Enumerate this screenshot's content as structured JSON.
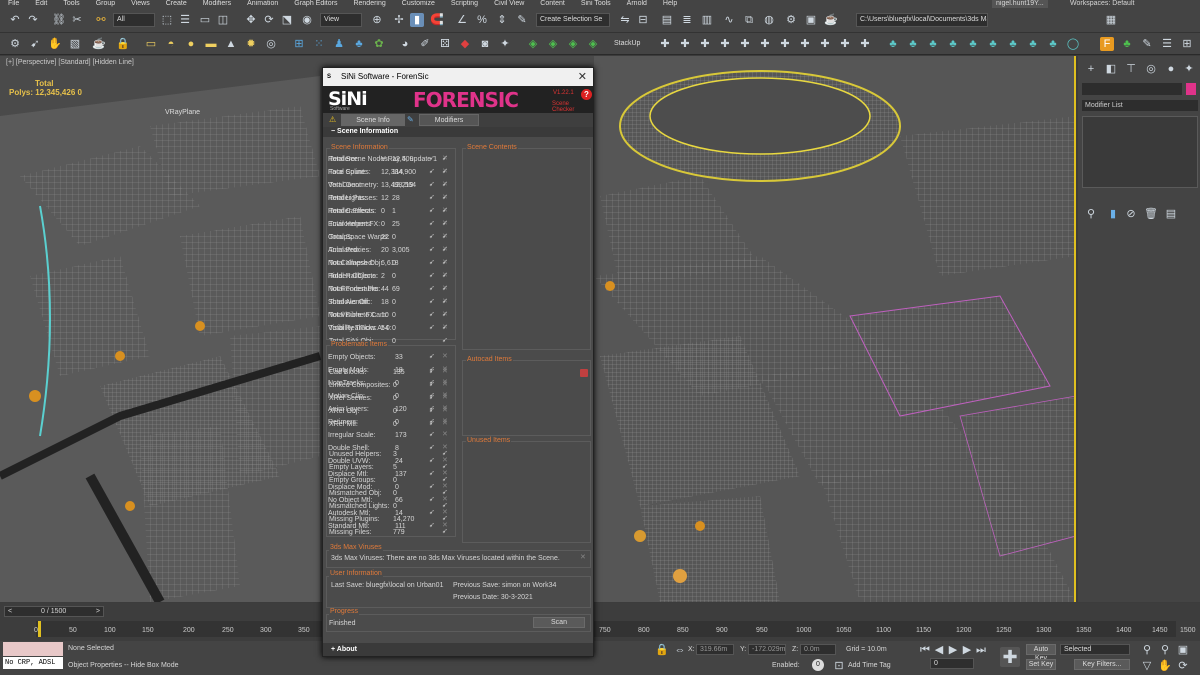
{
  "menu": [
    "File",
    "Edit",
    "Tools",
    "Group",
    "Views",
    "Create",
    "Modifiers",
    "Animation",
    "Graph Editors",
    "Rendering",
    "Customize",
    "Scripting",
    "Civil View",
    "Content",
    "Sini Tools",
    "Arnold",
    "Help"
  ],
  "user": "nigel.hunt19Y...",
  "workspaces": "Workspaces: Default",
  "toolbar": {
    "filter": "All",
    "view": "View",
    "selection_set": "Create Selection Se",
    "path": "C:\\Users\\bluegfx\\local\\Documents\\3ds Max 2022",
    "stackup": "StackUp"
  },
  "viewport": {
    "label": "[+] [Perspective] [Standard] [Hidden Line]",
    "total_label": "Total",
    "polys": "Polys:  12,345,426  0",
    "vray_plane": "VRayPlane"
  },
  "dialog": {
    "title": "SiNi Software - ForenSic",
    "logo": "SiNi",
    "logo_sub": "Software",
    "product": "FORENSIC",
    "version": "V1.22.1",
    "subtitle": "Scene Checker",
    "tabs": [
      "Scene Info",
      "Modifiers"
    ],
    "section": "Scene Information",
    "scene_info": {
      "title": "Scene Information",
      "rows": [
        {
          "label": "Renderer:",
          "value": "V-Ray 5, update 1"
        },
        {
          "label": "Face Count:",
          "value": "12,384,900"
        },
        {
          "label": "Vert Count:",
          "value": "13,498,564"
        },
        {
          "label": "Render Passes:",
          "value": "12"
        },
        {
          "label": "Render Effects:",
          "value": "0"
        },
        {
          "label": "Environment FX:",
          "value": "0"
        },
        {
          "label": "Groups:",
          "value": "22"
        },
        {
          "label": "Animated:",
          "value": "20"
        },
        {
          "label": "Not Collapsed:",
          "value": "6,618"
        },
        {
          "label": "Hidden Objects:",
          "value": "2"
        },
        {
          "label": "Not Renderable:",
          "value": "44"
        },
        {
          "label": "Shadows Off:",
          "value": "18"
        },
        {
          "label": "Not Visible to Cam:",
          "value": "10"
        },
        {
          "label": "Visibility Tracks At 0:",
          "value": "54"
        }
      ]
    },
    "scene_contents": {
      "title": "Scene Contents",
      "rows": [
        {
          "label": "Total Scene Nodes:",
          "value": "12,409"
        },
        {
          "label": "Total Splines:",
          "value": "114"
        },
        {
          "label": "Total Geometry:",
          "value": "12,219"
        },
        {
          "label": "Total Lights:",
          "value": "28"
        },
        {
          "label": "Total Cameras:",
          "value": "1"
        },
        {
          "label": "Total Helpers:",
          "value": "25"
        },
        {
          "label": "Total Space Warps:",
          "value": "0"
        },
        {
          "label": "Total Proxies:",
          "value": "3,005"
        },
        {
          "label": "Total Xmesh Obj:",
          "value": "0"
        },
        {
          "label": "Total RailClone:",
          "value": "0"
        },
        {
          "label": "Total Forest Pro:",
          "value": "69"
        },
        {
          "label": "Total Alembic:",
          "value": "0"
        },
        {
          "label": "Total Fume FX:",
          "value": "0"
        },
        {
          "label": "Total RealFlow:",
          "value": "0"
        },
        {
          "label": "Total SiNi Obj:",
          "value": "0"
        }
      ]
    },
    "problematic": {
      "title": "Problematic Items",
      "rows": [
        {
          "label": "Empty Objects:",
          "value": "33"
        },
        {
          "label": "Empty Mods:",
          "value": "18"
        },
        {
          "label": "NoteTracks:",
          "value": "0"
        },
        {
          "label": "Motion Clip:",
          "value": "0"
        },
        {
          "label": "Anim Layers:",
          "value": "120"
        },
        {
          "label": "Retimers:",
          "value": "0"
        },
        {
          "label": "Irregular Scale:",
          "value": "173"
        },
        {
          "label": "Double Shell:",
          "value": "8"
        },
        {
          "label": "Double UVW:",
          "value": "24"
        },
        {
          "label": "Displace Mtl:",
          "value": "137"
        },
        {
          "label": "Displace Mod:",
          "value": "0"
        },
        {
          "label": "No Object Mtl:",
          "value": "66"
        },
        {
          "label": "Autodesk Mtl:",
          "value": "14"
        },
        {
          "label": "Standard Mtl:",
          "value": "111"
        }
      ]
    },
    "autocad": {
      "title": "Autocad Items",
      "rows": [
        {
          "label": "Cad Blocks:",
          "value": "135"
        },
        {
          "label": "Linked Composites:",
          "value": "0"
        },
        {
          "label": "XRef Scenes:",
          "value": "0"
        },
        {
          "label": "XRef Obj:",
          "value": "0"
        },
        {
          "label": "XRef Mtl:",
          "value": "0"
        }
      ]
    },
    "unused": {
      "title": "Unused Items",
      "rows": [
        {
          "label": "Unused Helpers:",
          "value": "3"
        },
        {
          "label": "Empty Layers:",
          "value": "5"
        },
        {
          "label": "Empty Groups:",
          "value": "0"
        },
        {
          "label": "Mismatched Obj:",
          "value": "0"
        },
        {
          "label": "Mismatched Lights:",
          "value": "0"
        },
        {
          "label": "Missing Plugins:",
          "value": "14,270"
        },
        {
          "label": "Missing Files:",
          "value": "779"
        }
      ]
    },
    "viruses": {
      "title": "3ds Max Viruses",
      "text": "3ds Max Viruses:  There are no 3ds Max Viruses located within the Scene."
    },
    "user_info": {
      "title": "User Information",
      "last_save": "Last Save:  bluegfx\\local on Urban01",
      "prev_save": "Previous Save:  simon on Work34",
      "prev_date": "Previous Date:  30-3-2021"
    },
    "progress": {
      "title": "Progress",
      "status": "Finished",
      "scan": "Scan"
    },
    "about": "About"
  },
  "right_panel": {
    "modifier_list": "Modifier List"
  },
  "timeline": {
    "frame": "0 / 1500",
    "ticks": [
      "0",
      "50",
      "100",
      "150",
      "200",
      "250",
      "300",
      "350",
      "750",
      "800",
      "850",
      "900",
      "950",
      "1000",
      "1050",
      "1100",
      "1150",
      "1200",
      "1250",
      "1300",
      "1350",
      "1400",
      "1450",
      "1500"
    ]
  },
  "status": {
    "script": "No CRP, ADSL",
    "selected": "None Selected",
    "hint": "Object Properties -- Hide Box Mode",
    "x": "319.66m",
    "y": "-172.029m",
    "z": "0.0m",
    "grid": "Grid = 10.0m",
    "enabled": "Enabled:",
    "add_time_tag": "Add Time Tag",
    "auto_key": "Auto Key",
    "set_key": "Set Key",
    "key_mode": "Selected",
    "key_filters": "Key Filters...",
    "frame_num": "0"
  }
}
